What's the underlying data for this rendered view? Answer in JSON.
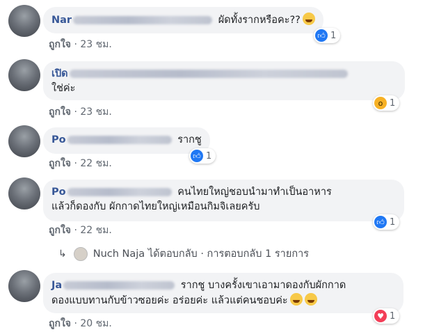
{
  "comments": [
    {
      "author": "Nar",
      "text": "ผัดทั้งรากหรือคะ??",
      "like_label": "ถูกใจ",
      "time": "23 ชม.",
      "reaction_count": "1",
      "reaction_icon": "like-icon"
    },
    {
      "author": "เปิด",
      "text": "ใช่ค่ะ",
      "like_label": "ถูกใจ",
      "time": "23 ชม.",
      "reaction_count": "1",
      "reaction_icon": "wow-icon"
    },
    {
      "author": "Po",
      "text": "รากชู",
      "like_label": "ถูกใจ",
      "time": "22 ชม.",
      "reaction_count": "1",
      "reaction_icon": "like-icon"
    },
    {
      "author": "Po",
      "text_line1": "คนไทยใหญ่ชอบนำมาทำเป็นอาหาร",
      "text_line2": "แล้วก็ดองกับ ผักกาดไทยใหญ่เหมือนกิมจิเลยครับ",
      "like_label": "ถูกใจ",
      "time": "22 ชม.",
      "reaction_count": "1",
      "reaction_icon": "like-icon"
    },
    {
      "author": "Ja",
      "text_line1": "รากชู บางครั้งเขาเอามาดองกับผักกาด",
      "text_line2": "ดองแบบทานกับข้าวซอยค่ะ อร่อยค่ะ แล้วแต่คนชอบค่ะ",
      "like_label": "ถูกใจ",
      "time": "20 ชม.",
      "reaction_count": "1",
      "reaction_icon": "love-icon"
    }
  ],
  "replies": {
    "name": "Nuch Naja",
    "text": "ได้ตอบกลับ · การตอบกลับ 1 รายการ"
  },
  "separator": "·",
  "colors": {
    "bubble": "#f2f3f5",
    "author": "#385898",
    "meta": "#606770",
    "like_reaction": "#2078f4",
    "love_reaction": "#f33e58"
  }
}
